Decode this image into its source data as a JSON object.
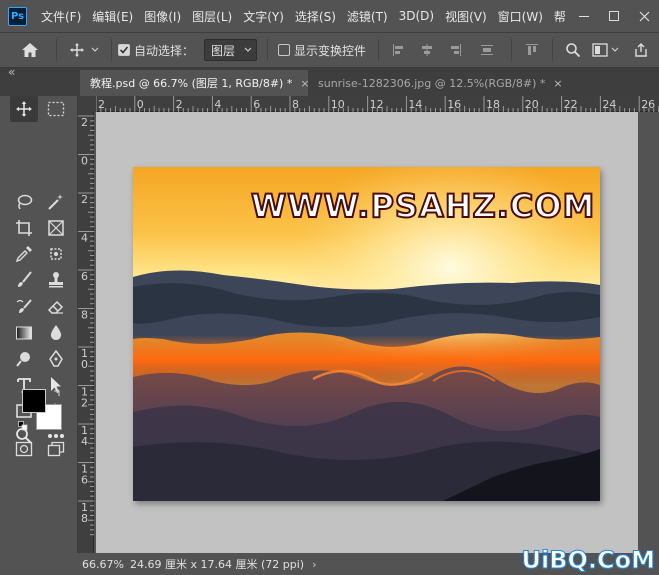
{
  "menu": {
    "items": [
      "文件(F)",
      "编辑(E)",
      "图像(I)",
      "图层(L)",
      "文字(Y)",
      "选择(S)",
      "滤镜(T)",
      "3D(D)",
      "视图(V)",
      "窗口(W)",
      "帮"
    ]
  },
  "app": {
    "logo_text": "Ps"
  },
  "options": {
    "auto_select_label": "自动选择：",
    "auto_select_value": "图层",
    "show_transform_label": "显示变换控件"
  },
  "tabs": [
    {
      "label": "教程.psd @ 66.7% (图层 1, RGB/8#) *",
      "close": "×",
      "active": true
    },
    {
      "label": "sunrise-1282306.jpg @ 12.5%(RGB/8#) *",
      "close": "×",
      "active": false
    }
  ],
  "ruler": {
    "h_labels": [
      "2",
      "0",
      "2",
      "4",
      "6",
      "8",
      "10",
      "12",
      "14",
      "16",
      "18",
      "20",
      "22",
      "24",
      "26"
    ],
    "v_labels": [
      "2",
      "0",
      "2",
      "4",
      "6",
      "8",
      "1\n0",
      "1\n2",
      "1\n4",
      "1\n6",
      "1\n8"
    ]
  },
  "canvas": {
    "watermark": "WWW.PSAHZ.COM"
  },
  "status": {
    "zoom": "66.67%",
    "doc_info": "24.69 厘米 x 17.64 厘米 (72 ppi)",
    "arrow": "›"
  },
  "brand": "UiBQ.CoM",
  "colors": {
    "foreground": "#000000",
    "background": "#ffffff",
    "ui_dark": "#535353",
    "ruler": "#3f3f3f",
    "canvas_bg": "#c2c2c2"
  }
}
